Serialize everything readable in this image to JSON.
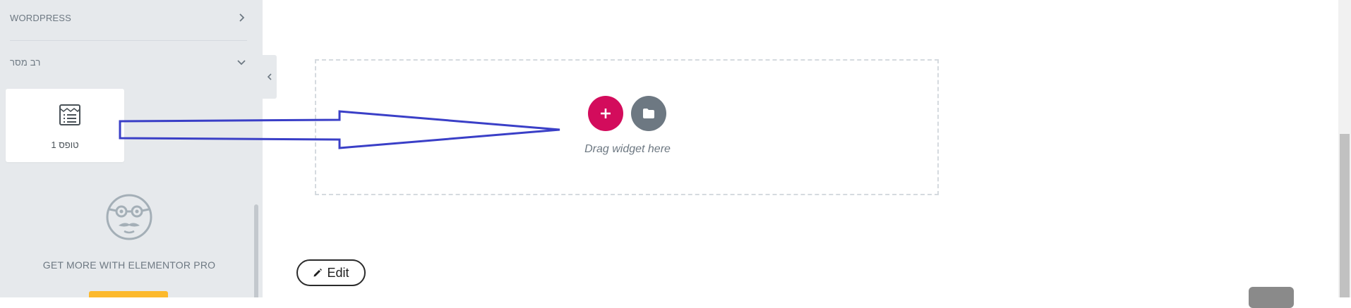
{
  "sidebar": {
    "categories": [
      {
        "label": "WORDPRESS",
        "chevron": "chevron-right-icon"
      },
      {
        "label": "רב מסר",
        "chevron": "chevron-down-icon"
      }
    ],
    "widget": {
      "label": "טופס 1",
      "icon": "form-icon"
    },
    "pro": {
      "icon": "nerd-face-icon",
      "text": "GET MORE WITH ELEMENTOR PRO",
      "button_color": "#fcb92c"
    },
    "collapse_icon": "chevron-left-icon"
  },
  "canvas": {
    "drop_zone_text": "Drag widget here",
    "add_button_icon": "plus-icon",
    "add_button_color": "#d30c5c",
    "template_button_icon": "folder-icon",
    "template_button_color": "#6d7882",
    "edit_label": "Edit",
    "edit_icon": "pencil-icon",
    "annotation_arrow_color": "#3a3fc7"
  }
}
